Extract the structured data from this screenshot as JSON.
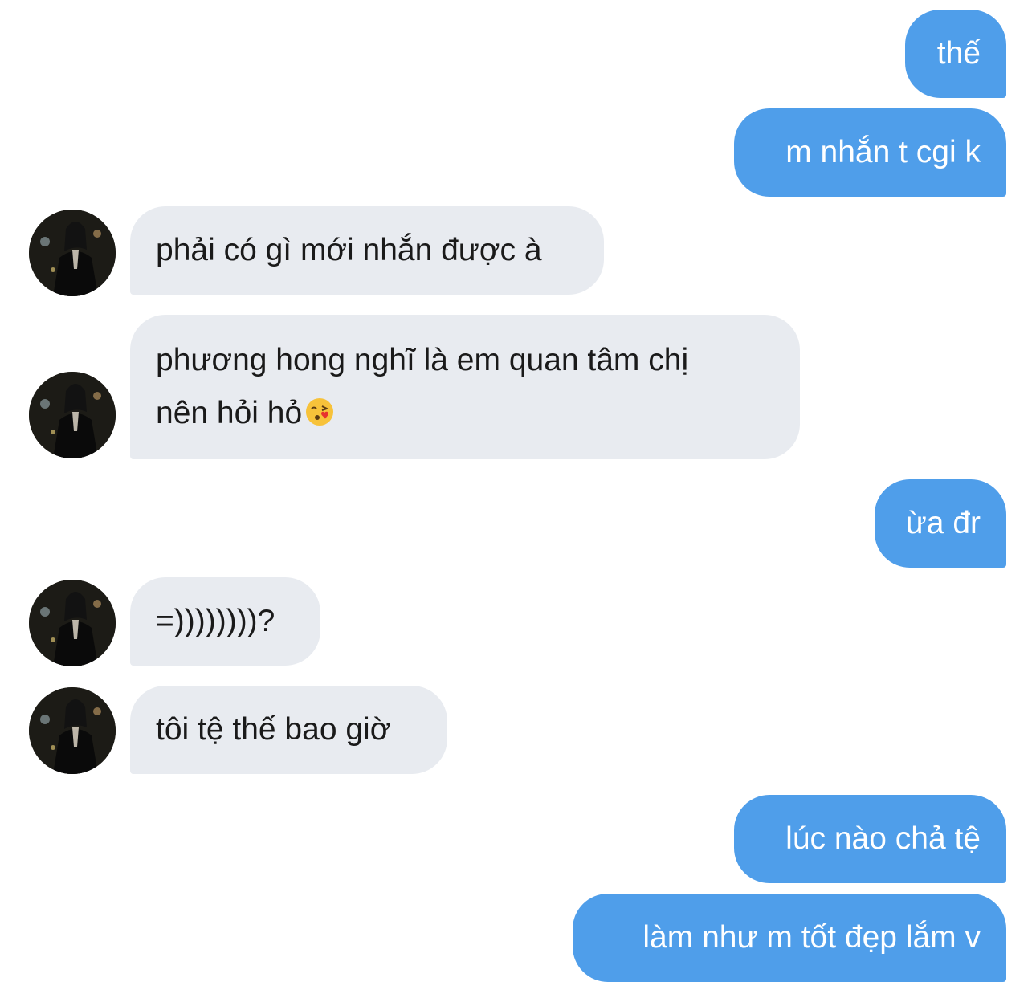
{
  "conversation": {
    "messages": [
      {
        "sender": "me",
        "text": "thế"
      },
      {
        "sender": "me",
        "text": "m nhắn t cgi k"
      },
      {
        "sender": "contact",
        "text": "phải có gì mới nhắn được à"
      },
      {
        "sender": "contact",
        "text_line1": "phương hong nghĩ là em quan tâm chị",
        "text_line2": "nên hỏi hỏ",
        "emoji": "face-blowing-kiss-emoji"
      },
      {
        "sender": "me",
        "text": "ừa đr"
      },
      {
        "sender": "contact",
        "text": "=))))))))?"
      },
      {
        "sender": "contact",
        "text": "tôi tệ thế bao giờ"
      },
      {
        "sender": "me",
        "text": "lúc nào chả tệ"
      },
      {
        "sender": "me",
        "text": "làm như m tốt đẹp lắm v"
      }
    ]
  },
  "colors": {
    "sent_bubble": "#4f9eea",
    "received_bubble": "#e8ebf0",
    "sent_text": "#ffffff",
    "received_text": "#1a1a1a"
  },
  "icons": {
    "avatar": "contact-avatar",
    "emoji": "face-blowing-kiss-emoji"
  }
}
